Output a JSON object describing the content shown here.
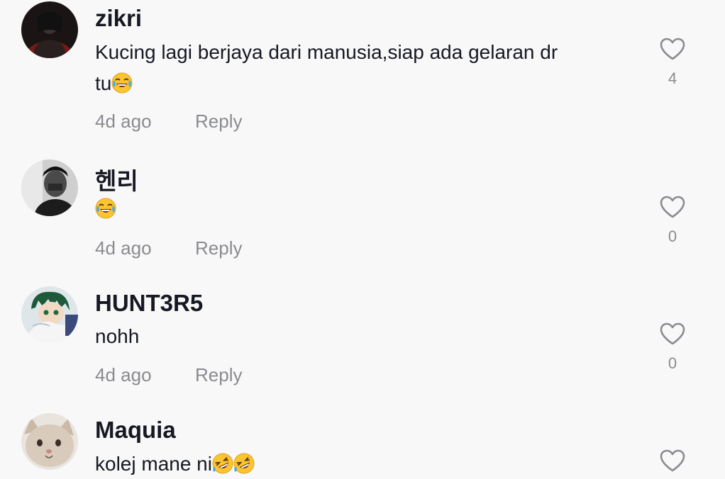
{
  "comments": [
    {
      "username": "zikri",
      "text_line1": "Kucing lagi berjaya dari manusia,siap ada gelaran dr",
      "text_line2": "tu",
      "emojis": [
        "face-with-tears-of-joy"
      ],
      "time": "4d ago",
      "reply_label": "Reply",
      "likes": "4",
      "avatar": "dark-hooded-figure-avatar"
    },
    {
      "username": "헨리",
      "text_line1": "",
      "emojis": [
        "face-with-tears-of-joy"
      ],
      "time": "4d ago",
      "reply_label": "Reply",
      "likes": "0",
      "avatar": "grayscale-person-avatar"
    },
    {
      "username": "HUNT3R5",
      "text_line1": "nohh",
      "time": "4d ago",
      "reply_label": "Reply",
      "likes": "0",
      "avatar": "anime-character-avatar"
    },
    {
      "username": "Maquia",
      "text_line1": "kolej mane ni",
      "emojis": [
        "rolling-on-floor-laughing",
        "rolling-on-floor-laughing"
      ],
      "avatar": "cat-avatar"
    }
  ],
  "colors": {
    "background": "#f8f8f8",
    "username": "#161823",
    "secondary": "#8a8b91",
    "heart_outline": "#8a8b91"
  }
}
